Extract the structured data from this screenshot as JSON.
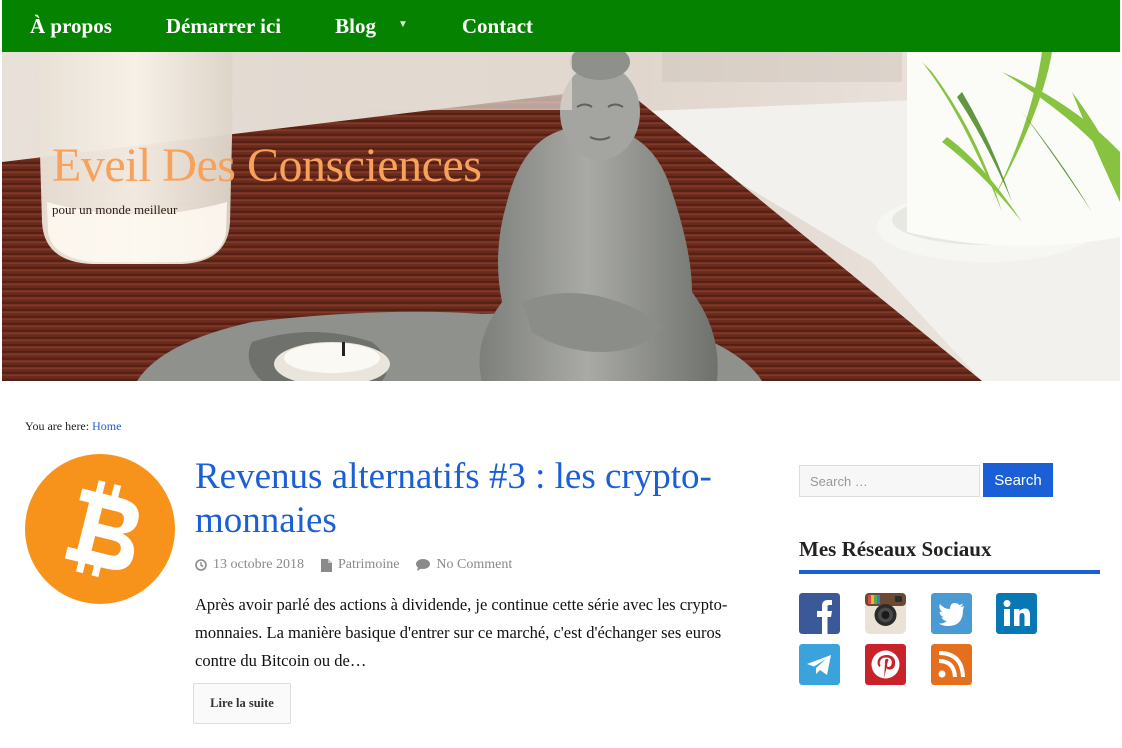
{
  "nav": {
    "items": [
      {
        "label": "À propos"
      },
      {
        "label": "Démarrer ici"
      },
      {
        "label": "Blog",
        "has_dropdown": true
      },
      {
        "label": "Contact"
      }
    ],
    "bg_color": "#058200"
  },
  "hero": {
    "site_title": "Eveil Des Consciences",
    "tagline": "pour un monde meilleur",
    "title_color": "#f7a15a"
  },
  "breadcrumb": {
    "prefix": "You are here:",
    "home_label": "Home"
  },
  "post": {
    "thumbnail_icon": "bitcoin-icon",
    "title": "Revenus alternatifs #3 : les crypto-monnaies",
    "date": "13 octobre 2018",
    "category": "Patrimoine",
    "comments": "No Comment",
    "excerpt": "Après avoir parlé des actions à dividende, je continue cette série avec les crypto-monnaies. La manière basique d'entrer sur ce marché, c'est d'échanger ses euros contre du Bitcoin ou de…",
    "read_more": "Lire la suite",
    "link_color": "#1a5fd6"
  },
  "sidebar": {
    "search": {
      "placeholder": "Search …",
      "button_label": "Search"
    },
    "social_widget": {
      "title": "Mes Réseaux Sociaux",
      "icons": [
        "facebook-icon",
        "instagram-icon",
        "twitter-icon",
        "linkedin-icon",
        "telegram-icon",
        "pinterest-icon",
        "rss-icon"
      ]
    }
  }
}
